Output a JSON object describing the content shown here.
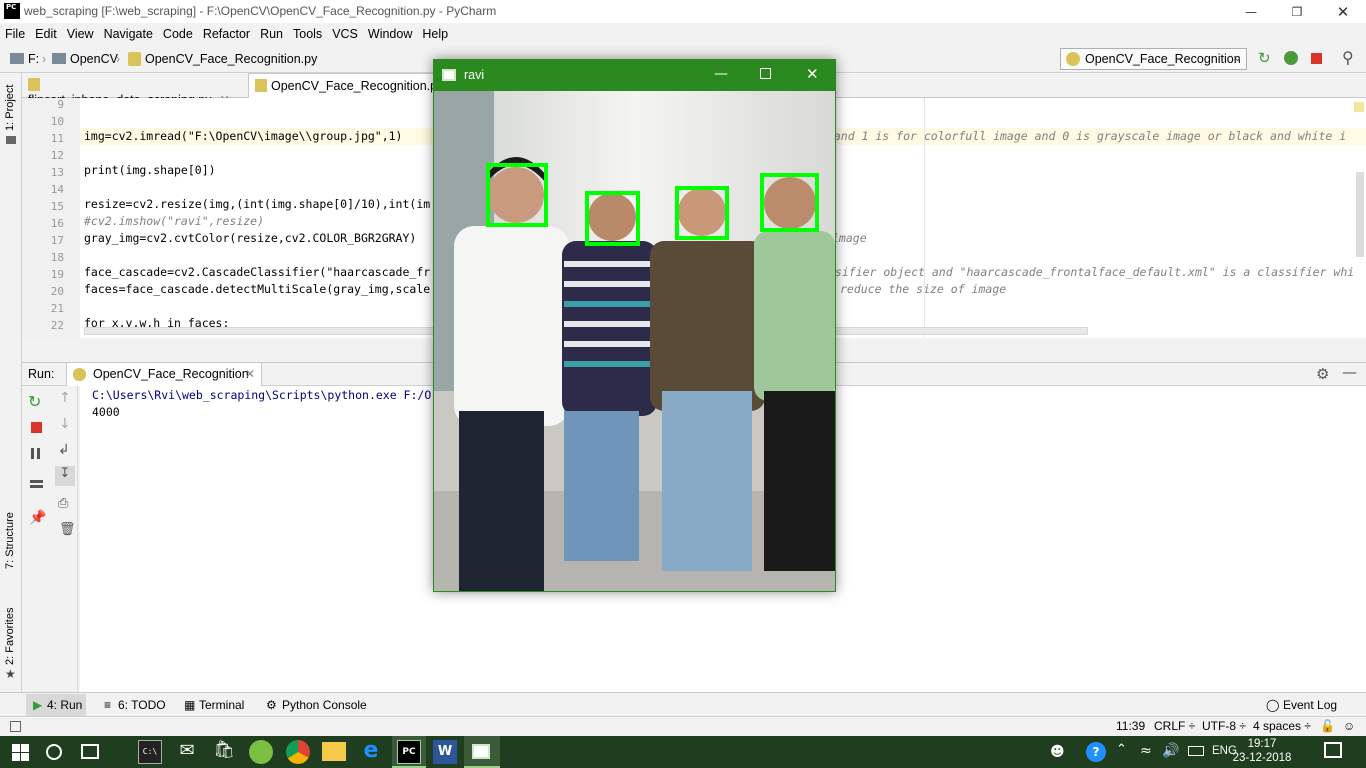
{
  "window": {
    "title": "web_scraping [F:\\web_scraping] - F:\\OpenCV\\OpenCV_Face_Recognition.py - PyCharm",
    "logo": "PC"
  },
  "menu": [
    "File",
    "Edit",
    "View",
    "Navigate",
    "Code",
    "Refactor",
    "Run",
    "Tools",
    "VCS",
    "Window",
    "Help"
  ],
  "breadcrumb": [
    "F:",
    "OpenCV",
    "OpenCV_Face_Recognition.py"
  ],
  "run_config": "OpenCV_Face_Recognition",
  "left_strip": {
    "project": "1: Project",
    "structure": "7: Structure",
    "favorites": "2: Favorites"
  },
  "tabs": [
    {
      "label": "flipcart_iphone_data_scraping.py",
      "active": false
    },
    {
      "label": "OpenCV_Face_Recognition.py",
      "active": true
    }
  ],
  "editor": {
    "line_numbers": [
      "9",
      "10",
      "11",
      "12",
      "13",
      "14",
      "15",
      "16",
      "17",
      "18",
      "19",
      "20",
      "21",
      "22"
    ],
    "lines": [
      "",
      "",
      "img=cv2.imread(\"F:\\OpenCV\\image\\\\group.jpg\",1)",
      "",
      "print(img.shape[0])",
      "",
      "resize=cv2.resize(img,(int(img.shape[0]/10),int(im",
      "#cv2.imshow(\"ravi\",resize)",
      "gray_img=cv2.cvtColor(resize,cv2.COLOR_BGR2GRAY)",
      "",
      "face_cascade=cv2.CascadeClassifier(\"haarcascade_fr",
      "faces=face_cascade.detectMultiScale(gray_img,scale",
      "",
      "for x,y,w,h in faces:"
    ],
    "right_comments": {
      "line11": "y and 1 is for colorfull image and 0 is grayscale image or black and white i",
      "line17": "image",
      "line19": "ssifier object and \"haarcascade_frontalface_default.xml\" is a classifier whi",
      "line20": "reduce the size of image"
    }
  },
  "run_panel": {
    "label": "Run:",
    "tab": "OpenCV_Face_Recognition",
    "output": [
      "C:\\Users\\Rvi\\web_scraping\\Scripts\\python.exe F:/O",
      "4000"
    ]
  },
  "bottom_tabs": [
    "4: Run",
    "6: TODO",
    "Terminal",
    "Python Console"
  ],
  "event_log": "Event Log",
  "status": {
    "position": "11:39",
    "line_sep": "CRLF ÷",
    "encoding": "UTF-8 ÷",
    "indent": "4 spaces ÷"
  },
  "cv_window": {
    "title": "ravi",
    "faces_detected": 4
  },
  "taskbar": {
    "lang": "ENG",
    "time": "19:17",
    "date": "23-12-2018"
  },
  "colors": {
    "accent_green": "#2b8a1f",
    "face_box": "#00ff00",
    "taskbar": "#1f3d1f"
  }
}
